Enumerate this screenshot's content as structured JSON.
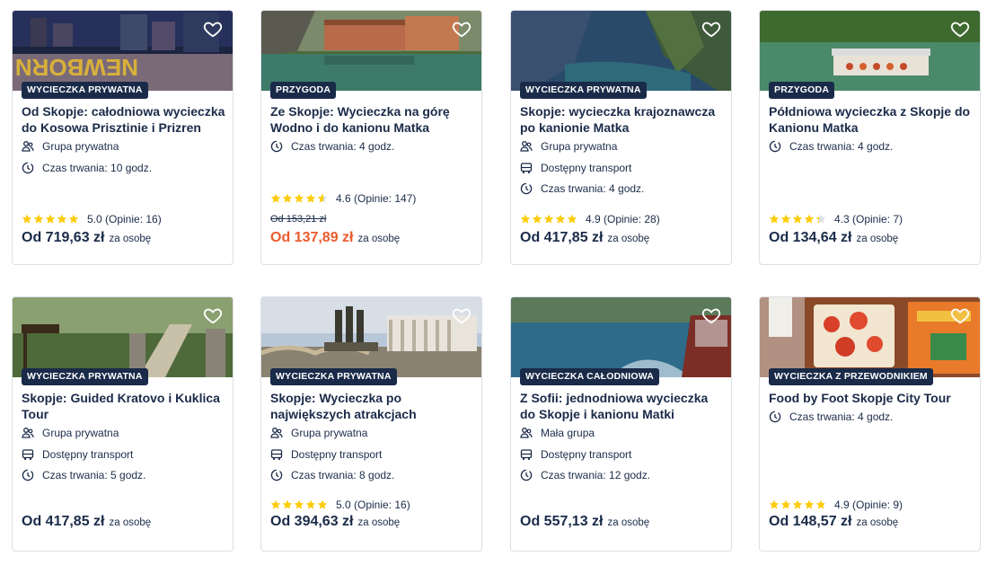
{
  "colors": {
    "navy": "#1a2b49",
    "sale": "#eb5a2d",
    "star": "#fdcc0d",
    "border": "#dcdfe4"
  },
  "cards": [
    {
      "badge": "WYCIECZKA PRYWATNA",
      "title": "Od Skopje: całodniowa wycieczka do Kosowa Prisztinie i Prizren",
      "features": [
        {
          "icon": "group-icon",
          "text": "Grupa prywatna"
        },
        {
          "icon": "duration-icon",
          "text": "Czas trwania: 10 godz."
        }
      ],
      "rating": {
        "stars": 5.0,
        "text": "5.0 (Opinie: 16)"
      },
      "price": {
        "amount": "Od 719,63 zł",
        "per": "za osobę"
      }
    },
    {
      "badge": "PRZYGODA",
      "title": "Ze Skopje: Wycieczka na górę Wodno i do kanionu Matka",
      "features": [
        {
          "icon": "duration-icon",
          "text": "Czas trwania: 4 godz."
        }
      ],
      "rating": {
        "stars": 4.6,
        "text": "4.6 (Opinie: 147)"
      },
      "old_price": "Od 153,21 zł",
      "price": {
        "amount": "Od 137,89 zł",
        "per": "za osobę"
      }
    },
    {
      "badge": "WYCIECZKA PRYWATNA",
      "title": "Skopje: wycieczka krajoznawcza po kanionie Matka",
      "features": [
        {
          "icon": "group-icon",
          "text": "Grupa prywatna"
        },
        {
          "icon": "bus-icon",
          "text": "Dostępny transport"
        },
        {
          "icon": "duration-icon",
          "text": "Czas trwania: 4 godz."
        }
      ],
      "rating": {
        "stars": 4.9,
        "text": "4.9 (Opinie: 28)"
      },
      "price": {
        "amount": "Od 417,85 zł",
        "per": "za osobę"
      }
    },
    {
      "badge": "PRZYGODA",
      "title": "Półdniowa wycieczka z Skopje do Kanionu Matka",
      "features": [
        {
          "icon": "duration-icon",
          "text": "Czas trwania: 4 godz."
        }
      ],
      "rating": {
        "stars": 4.3,
        "text": "4.3 (Opinie: 7)"
      },
      "price": {
        "amount": "Od 134,64 zł",
        "per": "za osobę"
      }
    },
    {
      "badge": "WYCIECZKA PRYWATNA",
      "title": "Skopje: Guided Kratovo i Kuklica Tour",
      "features": [
        {
          "icon": "group-icon",
          "text": "Grupa prywatna"
        },
        {
          "icon": "bus-icon",
          "text": "Dostępny transport"
        },
        {
          "icon": "duration-icon",
          "text": "Czas trwania: 5 godz."
        }
      ],
      "price": {
        "amount": "Od 417,85 zł",
        "per": "za osobę"
      }
    },
    {
      "badge": "WYCIECZKA PRYWATNA",
      "title": "Skopje: Wycieczka po największych atrakcjach",
      "features": [
        {
          "icon": "group-icon",
          "text": "Grupa prywatna"
        },
        {
          "icon": "bus-icon",
          "text": "Dostępny transport"
        },
        {
          "icon": "duration-icon",
          "text": "Czas trwania: 8 godz."
        }
      ],
      "rating": {
        "stars": 5.0,
        "text": "5.0 (Opinie: 16)"
      },
      "price": {
        "amount": "Od 394,63 zł",
        "per": "za osobę"
      }
    },
    {
      "badge": "WYCIECZKA CAŁODNIOWA",
      "title": "Z Sofii: jednodniowa wycieczka do Skopje i kanionu Matki",
      "features": [
        {
          "icon": "group-icon",
          "text": "Mała grupa"
        },
        {
          "icon": "bus-icon",
          "text": "Dostępny transport"
        },
        {
          "icon": "duration-icon",
          "text": "Czas trwania: 12 godz."
        }
      ],
      "price": {
        "amount": "Od 557,13 zł",
        "per": "za osobę"
      }
    },
    {
      "badge": "WYCIECZKA Z PRZEWODNIKIEM",
      "title": "Food by Foot Skopje City Tour",
      "features": [
        {
          "icon": "duration-icon",
          "text": "Czas trwania: 4 godz."
        }
      ],
      "rating": {
        "stars": 4.9,
        "text": "4.9 (Opinie: 9)"
      },
      "price": {
        "amount": "Od 148,57 zł",
        "per": "za osobę"
      }
    }
  ]
}
